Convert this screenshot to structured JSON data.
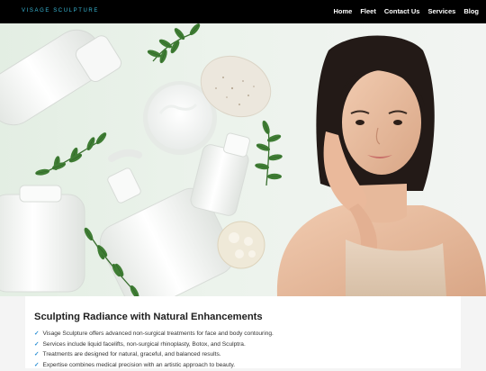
{
  "brand": {
    "name": "VISAGE SCULPTURE",
    "accent": "#39b8d6"
  },
  "nav": [
    {
      "label": "Home"
    },
    {
      "label": "Fleet"
    },
    {
      "label": "Contact Us"
    },
    {
      "label": "Services"
    },
    {
      "label": "Blog"
    }
  ],
  "hero": {
    "image": "skincare-products-and-model-photo"
  },
  "content": {
    "title": "Sculpting Radiance with Natural Enhancements",
    "check_icon": "checkmark-icon",
    "bullets": [
      "Visage Sculpture offers advanced non-surgical treatments for face and body contouring.",
      "Services include liquid facelifts, non-surgical rhinoplasty, Botox, and Sculptra.",
      "Treatments are designed for natural, graceful, and balanced results.",
      "Expertise combines medical precision with an artistic approach to beauty."
    ]
  }
}
